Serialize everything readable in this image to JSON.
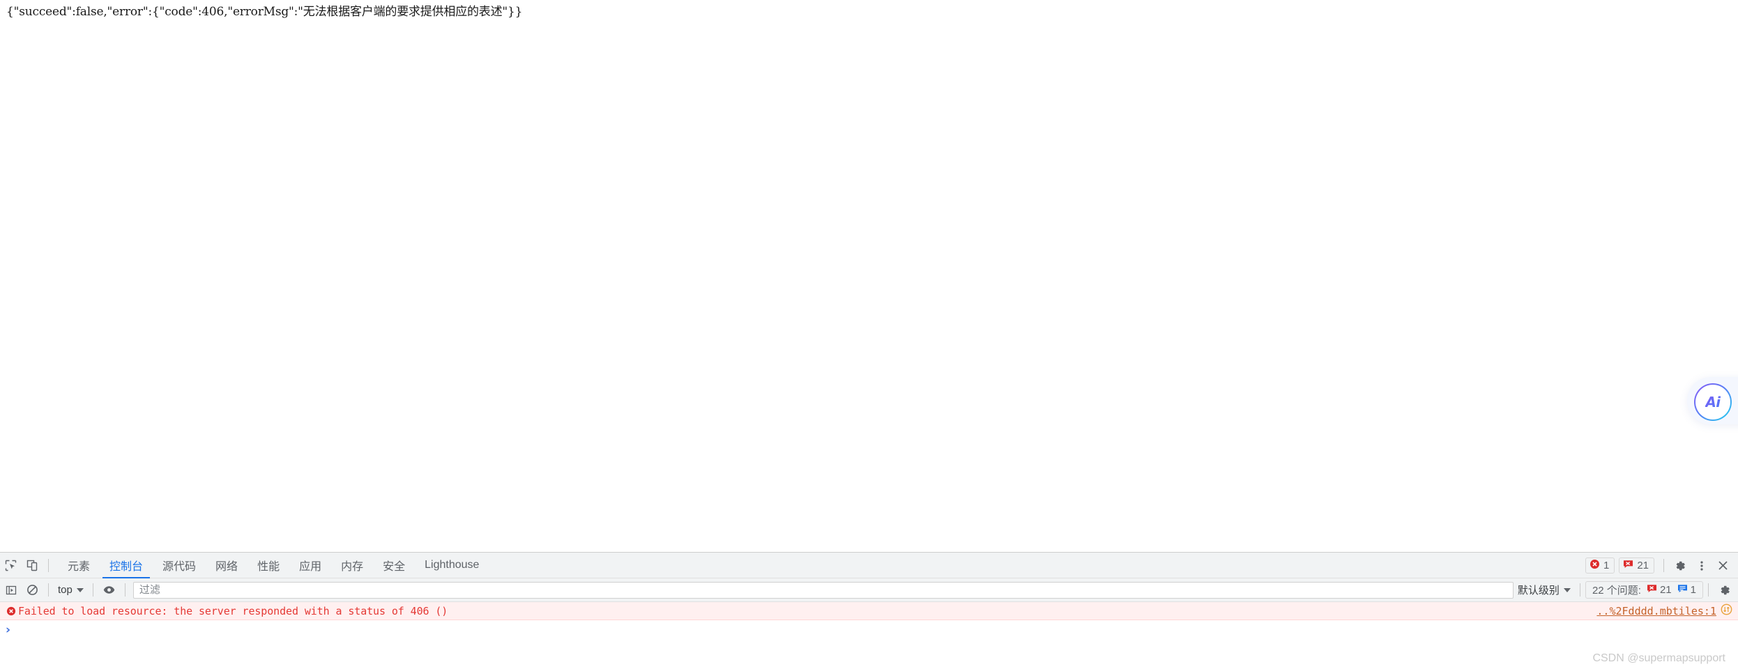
{
  "page": {
    "response_body": "{\"succeed\":false,\"error\":{\"code\":406,\"errorMsg\":\"无法根据客户端的要求提供相应的表述\"}}"
  },
  "ai_widget": {
    "label": "Ai"
  },
  "devtools": {
    "toolbar": {
      "inspect_icon": "inspect-element-icon",
      "device_icon": "device-toolbar-icon",
      "tabs": [
        {
          "label": "元素",
          "active": false
        },
        {
          "label": "控制台",
          "active": true
        },
        {
          "label": "源代码",
          "active": false
        },
        {
          "label": "网络",
          "active": false
        },
        {
          "label": "性能",
          "active": false
        },
        {
          "label": "应用",
          "active": false
        },
        {
          "label": "内存",
          "active": false
        },
        {
          "label": "安全",
          "active": false
        },
        {
          "label": "Lighthouse",
          "active": false
        }
      ],
      "error_count": "1",
      "issue_count": "21",
      "settings_icon": "gear-icon",
      "more_icon": "kebab-menu-icon",
      "close_icon": "close-icon"
    },
    "filterbar": {
      "sidebar_icon": "console-sidebar-icon",
      "clear_icon": "clear-console-icon",
      "context": "top",
      "eye_icon": "live-expression-eye-icon",
      "filter_placeholder": "过滤",
      "filter_value": "",
      "level": "默认级别",
      "issues_label": "22 个问题:",
      "issues_error_count": "21",
      "issues_info_count": "1",
      "settings_icon": "gear-icon"
    },
    "messages": [
      {
        "level": "error",
        "text": "Failed to load resource: the server responded with a status of 406 ()",
        "source": "..%2Fdddd.mbtiles:1",
        "badge_icon": "network-issue-icon"
      }
    ],
    "prompt": {
      "caret": "›",
      "value": ""
    }
  },
  "watermark": "CSDN @supermapsupport",
  "colors": {
    "accent": "#1a73e8",
    "error": "#e53935",
    "error_bg": "#fff0f0",
    "toolbar_bg": "#f1f3f4",
    "link": "#c5622a",
    "issue_orange": "#e8a33d"
  }
}
